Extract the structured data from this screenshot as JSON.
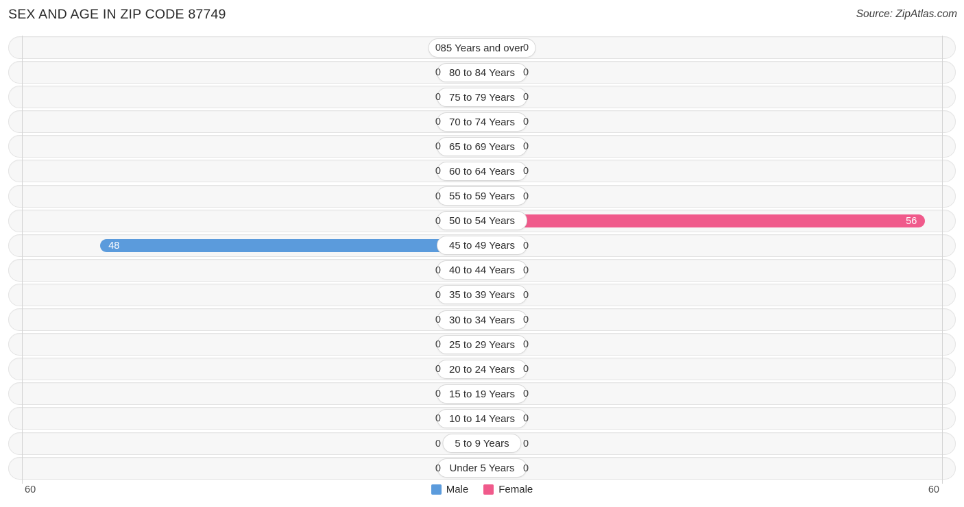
{
  "header": {
    "title": "SEX AND AGE IN ZIP CODE 87749",
    "source": "Source: ZipAtlas.com"
  },
  "legend": {
    "items": [
      {
        "label": "Male",
        "color": "#5b9bdc"
      },
      {
        "label": "Female",
        "color": "#f05a8b"
      }
    ]
  },
  "axis": {
    "left_tick": "60",
    "right_tick": "60"
  },
  "chart_data": {
    "type": "bar",
    "subtype": "population-pyramid",
    "title": "SEX AND AGE IN ZIP CODE 87749",
    "xlabel": "",
    "ylabel": "",
    "xlim": [
      -60,
      60
    ],
    "axis_max": 60,
    "grid": false,
    "legend_position": "bottom-center",
    "categories": [
      "85 Years and over",
      "80 to 84 Years",
      "75 to 79 Years",
      "70 to 74 Years",
      "65 to 69 Years",
      "60 to 64 Years",
      "55 to 59 Years",
      "50 to 54 Years",
      "45 to 49 Years",
      "40 to 44 Years",
      "35 to 39 Years",
      "30 to 34 Years",
      "25 to 29 Years",
      "20 to 24 Years",
      "15 to 19 Years",
      "10 to 14 Years",
      "5 to 9 Years",
      "Under 5 Years"
    ],
    "series": [
      {
        "name": "Male",
        "color": "#5b9bdc",
        "values": [
          0,
          0,
          0,
          0,
          0,
          0,
          0,
          0,
          48,
          0,
          0,
          0,
          0,
          0,
          0,
          0,
          0,
          0
        ]
      },
      {
        "name": "Female",
        "color": "#f05a8b",
        "values": [
          0,
          0,
          0,
          0,
          0,
          0,
          0,
          56,
          0,
          0,
          0,
          0,
          0,
          0,
          0,
          0,
          0,
          0
        ]
      }
    ]
  },
  "rows": [
    {
      "label": "85 Years and over",
      "male": "0",
      "female": "0"
    },
    {
      "label": "80 to 84 Years",
      "male": "0",
      "female": "0"
    },
    {
      "label": "75 to 79 Years",
      "male": "0",
      "female": "0"
    },
    {
      "label": "70 to 74 Years",
      "male": "0",
      "female": "0"
    },
    {
      "label": "65 to 69 Years",
      "male": "0",
      "female": "0"
    },
    {
      "label": "60 to 64 Years",
      "male": "0",
      "female": "0"
    },
    {
      "label": "55 to 59 Years",
      "male": "0",
      "female": "0"
    },
    {
      "label": "50 to 54 Years",
      "male": "0",
      "female": "56"
    },
    {
      "label": "45 to 49 Years",
      "male": "48",
      "female": "0"
    },
    {
      "label": "40 to 44 Years",
      "male": "0",
      "female": "0"
    },
    {
      "label": "35 to 39 Years",
      "male": "0",
      "female": "0"
    },
    {
      "label": "30 to 34 Years",
      "male": "0",
      "female": "0"
    },
    {
      "label": "25 to 29 Years",
      "male": "0",
      "female": "0"
    },
    {
      "label": "20 to 24 Years",
      "male": "0",
      "female": "0"
    },
    {
      "label": "15 to 19 Years",
      "male": "0",
      "female": "0"
    },
    {
      "label": "10 to 14 Years",
      "male": "0",
      "female": "0"
    },
    {
      "label": "5 to 9 Years",
      "male": "0",
      "female": "0"
    },
    {
      "label": "Under 5 Years",
      "male": "0",
      "female": "0"
    }
  ]
}
